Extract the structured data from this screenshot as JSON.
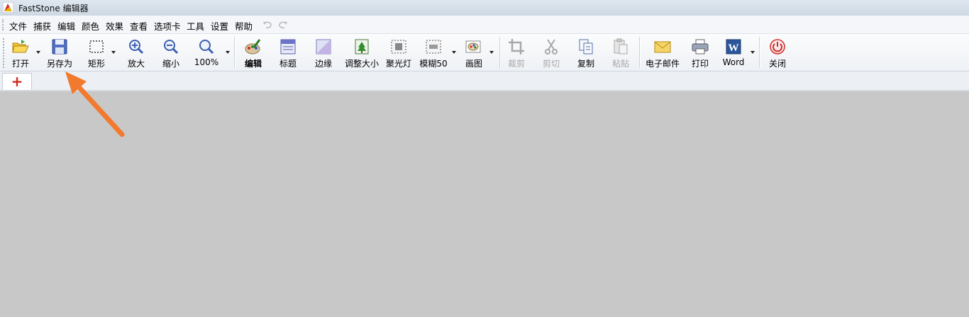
{
  "window": {
    "title": "FastStone 编辑器"
  },
  "menu": [
    "文件",
    "捕获",
    "编辑",
    "颜色",
    "效果",
    "查看",
    "选项卡",
    "工具",
    "设置",
    "帮助"
  ],
  "toolbar": {
    "open": "打开",
    "save_as": "另存为",
    "rectangle": "矩形",
    "zoom_in": "放大",
    "zoom_out": "缩小",
    "zoom_level": "100%",
    "edit": "编辑",
    "caption": "标题",
    "edge": "边缘",
    "resize": "调整大小",
    "spotlight": "聚光灯",
    "blur": "模糊50",
    "paint": "画图",
    "crop": "裁剪",
    "cut": "剪切",
    "copy": "复制",
    "paste": "粘贴",
    "email": "电子邮件",
    "print": "打印",
    "word": "Word",
    "close": "关闭"
  },
  "tabs": {
    "add_symbol": "+"
  },
  "colors": {
    "accent_arrow": "#f27a2e",
    "workspace": "#c8c8c8",
    "tab_plus": "#d0281e"
  }
}
